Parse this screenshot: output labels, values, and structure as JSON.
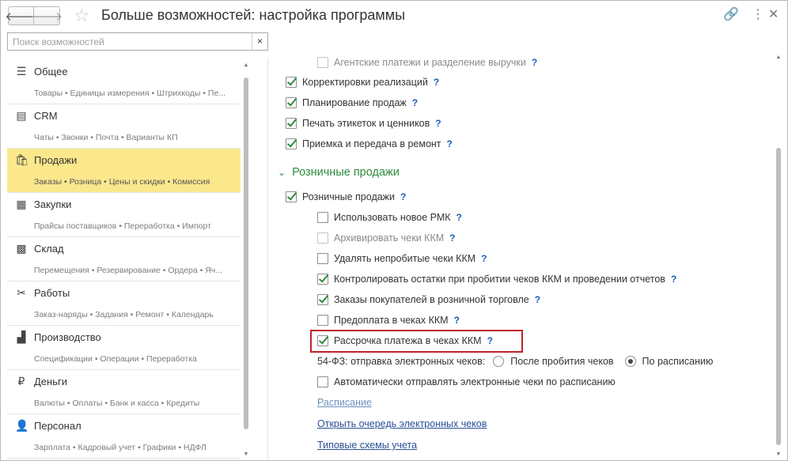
{
  "header": {
    "title": "Больше возможностей: настройка программы",
    "back_icon": "🡐",
    "forward_icon": "🡒",
    "star_icon": "☆",
    "link_icon": "🔗",
    "more_icon": "⋮",
    "close_icon": "✕"
  },
  "search": {
    "placeholder": "Поиск возможностей",
    "clear_icon": "×"
  },
  "nav": {
    "sections": [
      {
        "icon": "☰",
        "name": "Общее",
        "sub": "Товары • Единицы измерения • Штрихкоды • Пе..."
      },
      {
        "icon": "▤",
        "name": "CRM",
        "sub": "Чаты • Звонки • Почта • Варианты КП"
      },
      {
        "icon": "🛍",
        "name": "Продажи",
        "sub": "Заказы • Розница • Цены и скидки • Комиссия"
      },
      {
        "icon": "▦",
        "name": "Закупки",
        "sub": "Прайсы поставщиков • Переработка • Импорт"
      },
      {
        "icon": "▩",
        "name": "Склад",
        "sub": "Перемещения • Резервирование • Ордера • Яч..."
      },
      {
        "icon": "✂",
        "name": "Работы",
        "sub": "Заказ-наряды • Задания • Ремонт • Календарь"
      },
      {
        "icon": "▟",
        "name": "Производство",
        "sub": "Спецификации • Операции • Переработка"
      },
      {
        "icon": "₽",
        "name": "Деньги",
        "sub": "Валюты • Оплаты • Банк и касса • Кредиты"
      },
      {
        "icon": "👤",
        "name": "Персонал",
        "sub": "Зарплата • Кадровый учет • Графики • НДФЛ"
      }
    ]
  },
  "content": {
    "items_top": [
      {
        "label": "Агентские платежи и разделение выручки",
        "q": "?"
      },
      {
        "label": "Корректировки реализаций",
        "q": "?"
      },
      {
        "label": "Планирование продаж",
        "q": "?"
      },
      {
        "label": "Печать этикеток и ценников",
        "q": "?"
      },
      {
        "label": "Приемка и передача в ремонт",
        "q": "?"
      }
    ],
    "group": {
      "chevron": "⌄",
      "title": "Розничные продажи"
    },
    "retail": {
      "label": "Розничные продажи",
      "q": "?"
    },
    "sub_items": [
      {
        "label": "Использовать новое РМК",
        "q": "?"
      },
      {
        "label": "Архивировать чеки ККМ",
        "q": "?"
      },
      {
        "label": "Удалять непробитые чеки ККМ",
        "q": "?"
      },
      {
        "label": "Контролировать остатки при пробитии чеков ККМ и проведении отчетов",
        "q": "?"
      },
      {
        "label": "Заказы покупателей в розничной торговле",
        "q": "?"
      },
      {
        "label": "Предоплата в чеках ККМ",
        "q": "?"
      },
      {
        "label": "Рассрочка платежа в чеках ККМ",
        "q": "?"
      }
    ],
    "fz": {
      "label": "54-ФЗ: отправка электронных чеков:",
      "opt1": "После пробития чеков",
      "opt2": "По расписанию"
    },
    "auto_send": {
      "label": "Автоматически отправлять электронные чеки по расписанию"
    },
    "links": {
      "schedule": "Расписание",
      "queue": "Открыть очередь электронных чеков",
      "schemes": "Типовые схемы учета"
    }
  },
  "scroll": {
    "up": "▲",
    "down": "▼"
  }
}
